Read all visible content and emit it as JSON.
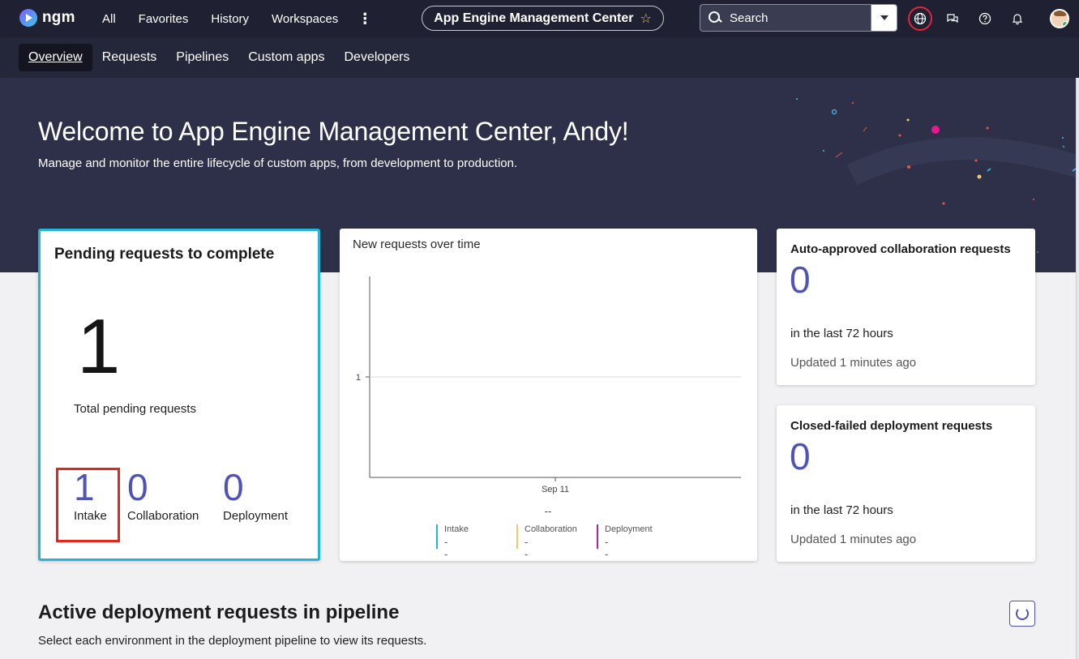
{
  "app": {
    "logo_text": "ngm"
  },
  "topnav": {
    "items": [
      "All",
      "Favorites",
      "History",
      "Workspaces"
    ],
    "more_icon": "⋮"
  },
  "page_pill": {
    "title": "App Engine Management Center",
    "star_icon": "star-icon"
  },
  "search": {
    "placeholder": "Search"
  },
  "header_icons": [
    "globe-icon",
    "chat-icon",
    "help-icon",
    "bell-icon",
    "avatar"
  ],
  "subnav": {
    "tabs": [
      "Overview",
      "Requests",
      "Pipelines",
      "Custom apps",
      "Developers"
    ],
    "active": "Overview"
  },
  "hero": {
    "title": "Welcome to App Engine Management Center, Andy!",
    "subtitle": "Manage and monitor the entire lifecycle of custom apps, from development to production."
  },
  "pending": {
    "title": "Pending requests to complete",
    "total": "1",
    "total_label": "Total pending requests",
    "breakdown": [
      {
        "value": "1",
        "label": "Intake"
      },
      {
        "value": "0",
        "label": "Collaboration"
      },
      {
        "value": "0",
        "label": "Deployment"
      }
    ]
  },
  "chart_data": {
    "type": "line",
    "title": "New requests over time",
    "categories": [
      "Sep 11"
    ],
    "ytick_labels": [
      "1"
    ],
    "summary": "--",
    "legend": [
      {
        "name": "Intake",
        "value": "--",
        "color": "#23b5d8"
      },
      {
        "name": "Collaboration",
        "value": "--",
        "color": "#f5c76a"
      },
      {
        "name": "Deployment",
        "value": "--",
        "color": "#b0268f"
      }
    ],
    "grid": true
  },
  "auto_approved": {
    "title": "Auto-approved collaboration requests",
    "value": "0",
    "period": "in the last 72 hours",
    "updated": "Updated 1 minutes ago"
  },
  "closed_failed": {
    "title": "Closed-failed deployment requests",
    "value": "0",
    "period": "in the last 72 hours",
    "updated": "Updated 1 minutes ago"
  },
  "active_section": {
    "title": "Active deployment requests in pipeline",
    "subtitle": "Select each environment in the deployment pipeline to view its requests."
  }
}
